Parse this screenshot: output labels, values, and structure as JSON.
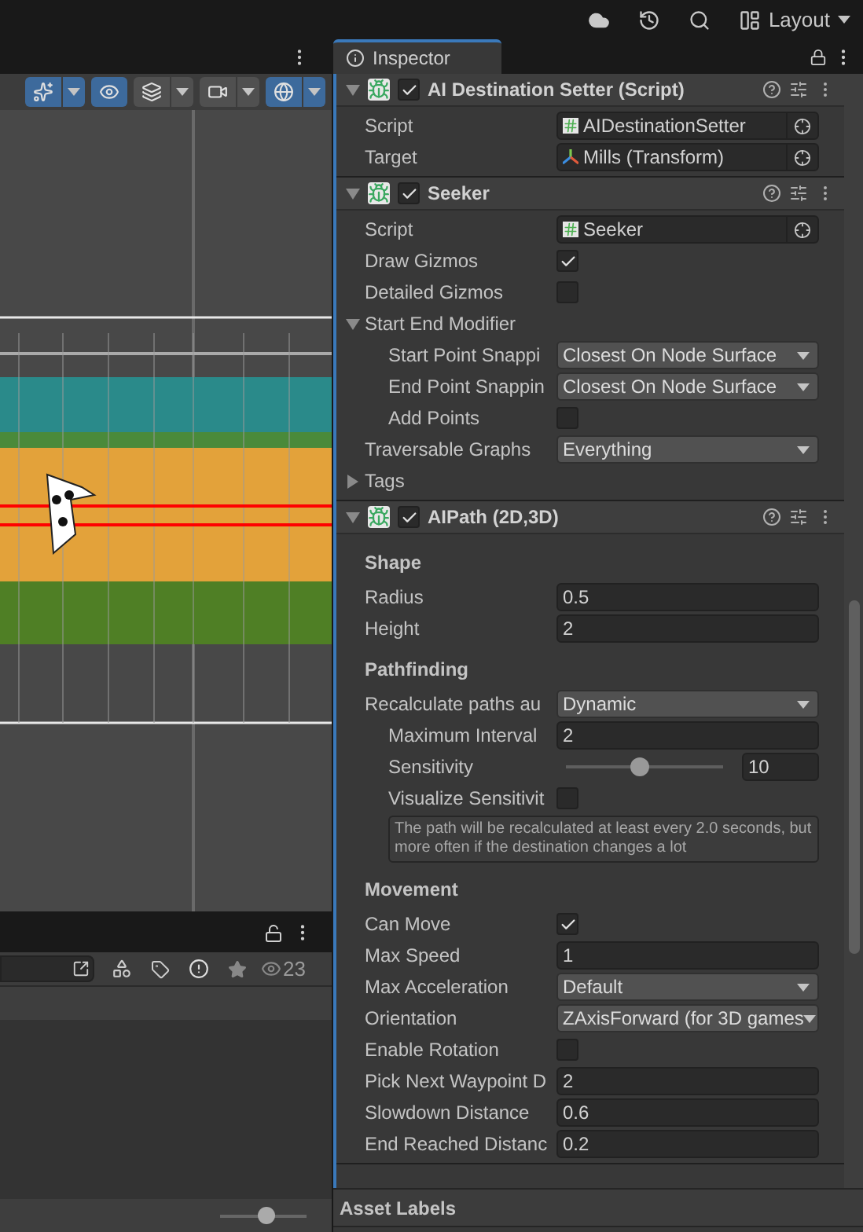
{
  "top_bar": {
    "layout_label": "Layout"
  },
  "scene_toolbar": [
    {
      "kind": "effects",
      "on": true
    },
    {
      "kind": "visibility",
      "on": true
    },
    {
      "kind": "layers",
      "on": false
    },
    {
      "kind": "camera",
      "on": false
    },
    {
      "kind": "gizmos",
      "on": true
    }
  ],
  "inspector_tab": {
    "label": "Inspector",
    "selected": true
  },
  "components": [
    {
      "title": "AI Destination Setter (Script)",
      "enabled": true,
      "expanded": true,
      "rows": [
        {
          "kind": "script",
          "label": "Script",
          "value": "AIDestinationSetter"
        },
        {
          "kind": "object",
          "label": "Target",
          "value": "Mills (Transform)"
        }
      ]
    },
    {
      "title": "Seeker",
      "enabled": true,
      "expanded": true,
      "rows": [
        {
          "kind": "script",
          "label": "Script",
          "value": "Seeker"
        },
        {
          "kind": "checkbox",
          "label": "Draw Gizmos",
          "checked": true
        },
        {
          "kind": "checkbox",
          "label": "Detailed Gizmos",
          "checked": false
        },
        {
          "kind": "foldout",
          "label": "Start End Modifier",
          "expanded": true,
          "children": [
            {
              "kind": "dropdown",
              "label": "Start Point Snappi",
              "value": "Closest On Node Surface"
            },
            {
              "kind": "dropdown",
              "label": "End Point Snappin",
              "value": "Closest On Node Surface"
            },
            {
              "kind": "checkbox",
              "label": "Add Points",
              "checked": false
            }
          ]
        },
        {
          "kind": "dropdown",
          "label": "Traversable Graphs",
          "value": "Everything"
        },
        {
          "kind": "foldout",
          "label": "Tags",
          "expanded": false
        }
      ]
    },
    {
      "title": "AIPath (2D,3D)",
      "enabled": true,
      "expanded": true,
      "rows": [
        {
          "kind": "header",
          "label": "Shape"
        },
        {
          "kind": "number",
          "label": "Radius",
          "value": "0.5"
        },
        {
          "kind": "number",
          "label": "Height",
          "value": "2"
        },
        {
          "kind": "header",
          "label": "Pathfinding"
        },
        {
          "kind": "dropdown",
          "label": "Recalculate paths au",
          "value": "Dynamic"
        },
        {
          "kind": "group",
          "children": [
            {
              "kind": "number",
              "label": "Maximum Interval",
              "value": "2"
            },
            {
              "kind": "slider",
              "label": "Sensitivity",
              "value": "10",
              "level": 0.47
            },
            {
              "kind": "checkbox",
              "label": "Visualize Sensitivit",
              "checked": false
            },
            {
              "kind": "helpbox",
              "text": "The path will be recalculated at least every 2.0 seconds, but more often if the destination changes a lot"
            }
          ]
        },
        {
          "kind": "header",
          "label": "Movement"
        },
        {
          "kind": "checkbox",
          "label": "Can Move",
          "checked": true
        },
        {
          "kind": "number",
          "label": "Max Speed",
          "value": "1"
        },
        {
          "kind": "dropdown",
          "label": "Max Acceleration",
          "value": "Default"
        },
        {
          "kind": "dropdown",
          "label": "Orientation",
          "value": "ZAxisForward (for 3D games"
        },
        {
          "kind": "checkbox",
          "label": "Enable Rotation",
          "checked": false
        },
        {
          "kind": "number",
          "label": "Pick Next Waypoint D",
          "value": "2"
        },
        {
          "kind": "number",
          "label": "Slowdown Distance",
          "value": "0.6"
        },
        {
          "kind": "number",
          "label": "End Reached Distanc",
          "value": "0.2"
        }
      ]
    }
  ],
  "asset_labels": {
    "title": "Asset Labels"
  },
  "project_panel": {
    "hidden_count": "23",
    "zoom": {
      "level": 0.55
    }
  }
}
